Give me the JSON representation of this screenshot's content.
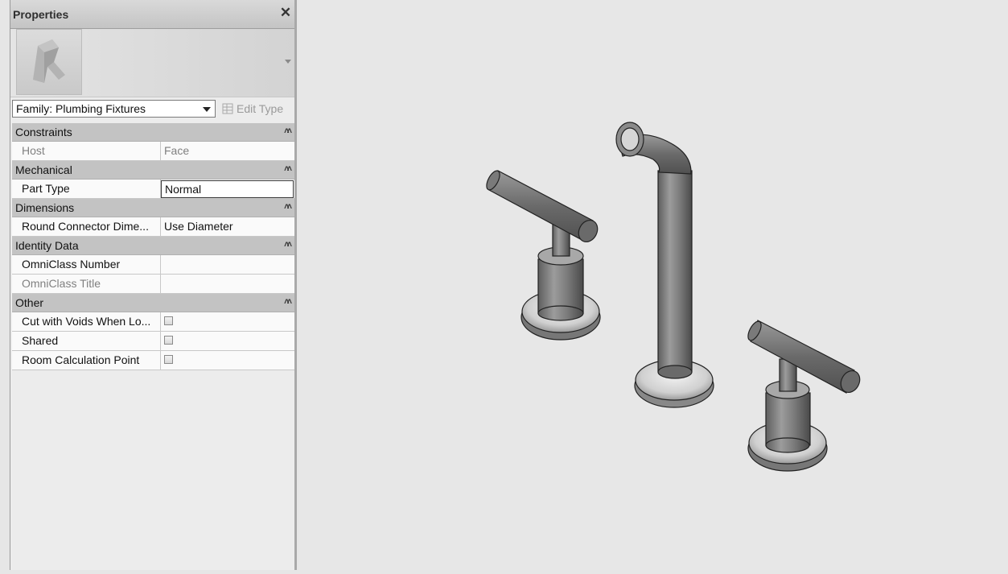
{
  "panel": {
    "title": "Properties",
    "close_icon": "close-icon",
    "type_selector": "Family: Plumbing Fixtures",
    "edit_type_label": "Edit Type"
  },
  "categories": [
    {
      "name": "Constraints",
      "rows": [
        {
          "name": "Host",
          "value": "Face",
          "dim": true
        }
      ]
    },
    {
      "name": "Mechanical",
      "rows": [
        {
          "name": "Part Type",
          "value": "Normal",
          "boxed": true
        }
      ]
    },
    {
      "name": "Dimensions",
      "rows": [
        {
          "name": "Round Connector Dime...",
          "value": "Use Diameter"
        }
      ]
    },
    {
      "name": "Identity Data",
      "rows": [
        {
          "name": "OmniClass Number",
          "value": ""
        },
        {
          "name": "OmniClass Title",
          "value": "",
          "dim": true
        }
      ]
    },
    {
      "name": "Other",
      "rows": [
        {
          "name": "Cut with Voids When Lo...",
          "checkbox": true,
          "checked": false
        },
        {
          "name": "Shared",
          "checkbox": true,
          "checked": false
        },
        {
          "name": "Room Calculation Point",
          "checkbox": true,
          "checked": false
        }
      ]
    }
  ],
  "viewport": {
    "model": "faucet-3d-model"
  }
}
